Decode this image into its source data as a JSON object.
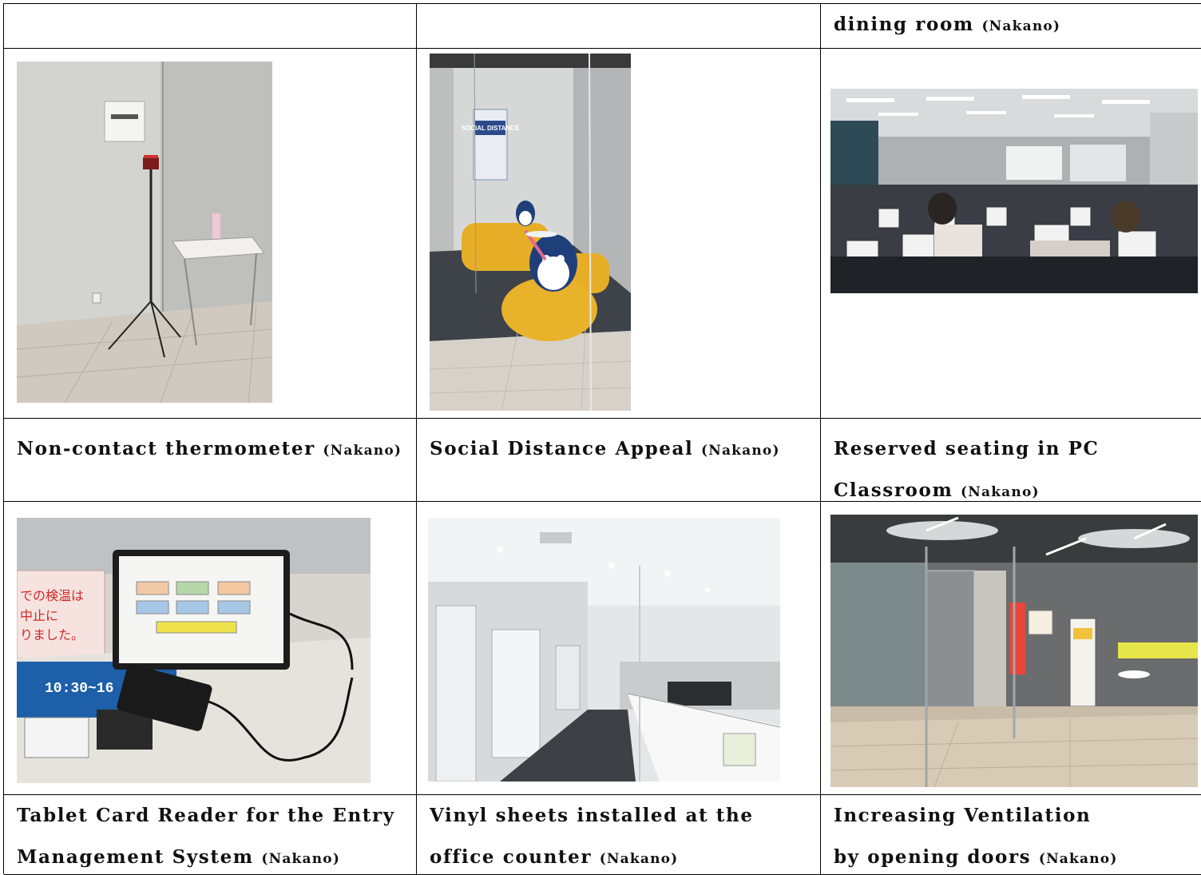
{
  "table": {
    "header_row": {
      "cell_3_title": "dining room",
      "cell_3_loc": "(Nakano)"
    },
    "captions": [
      {
        "title": "Non-contact thermometer",
        "loc": "(Nakano)"
      },
      {
        "title": "Social Distance Appeal",
        "loc": "(Nakano)"
      },
      {
        "title": "Reserved seating in PC Classroom",
        "loc": "(Nakano)"
      },
      {
        "title": "Tablet Card Reader for the Entry Management System",
        "loc": "(Nakano)"
      },
      {
        "title": "Vinyl sheets installed at the office counter",
        "loc": "(Nakano)"
      },
      {
        "title": "Increasing Ventilation by opening doors",
        "loc": "(Nakano)"
      }
    ]
  },
  "photo_text": {
    "poster_social": "SOCIAL DISTANCE",
    "sign_line1": "での検温は",
    "sign_line2": "中止に",
    "sign_line3": "りました。",
    "tablet_time": "10:30~16"
  },
  "colors": {
    "table_border": "#000000",
    "text": "#111111",
    "wall_gray": "#cfd0cc",
    "floor_tan": "#d8cbb8",
    "sofa_yellow": "#e8b22a"
  }
}
